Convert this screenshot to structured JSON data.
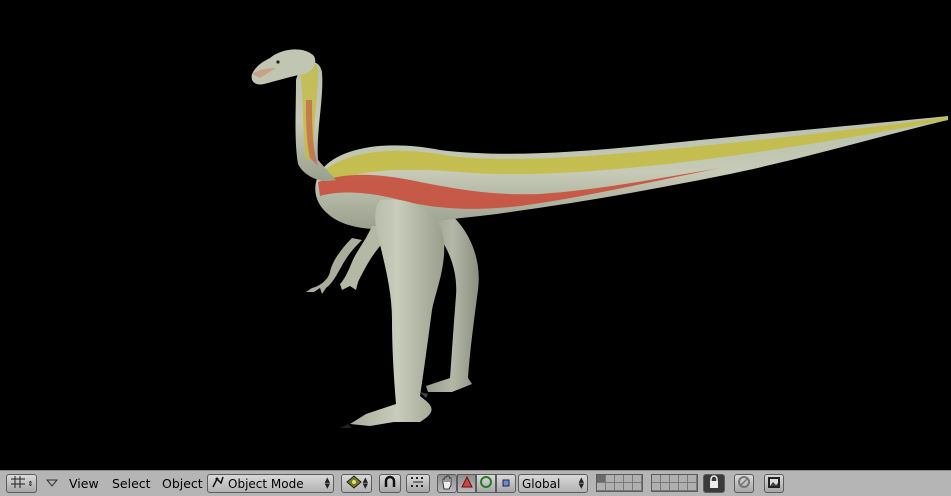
{
  "header": {
    "menus": {
      "view": "View",
      "select": "Select",
      "object": "Object"
    },
    "mode_select": {
      "value": "Object Mode"
    },
    "orientation_select": {
      "value": "Global"
    },
    "layers": {
      "group1_active_index": 0
    }
  },
  "icons": {
    "editor_type": "grid-icon",
    "menu_collapse": "triangle-down-icon",
    "mode": "object-mode-icon",
    "pivot": "pivot-cube-icon",
    "proportional": "magnet-icon",
    "snap": "snap-dots-icon",
    "manipulator": "hand-icon",
    "translate": "triangle-icon",
    "rotate": "circle-icon",
    "scale": "square-icon",
    "lock": "lock-icon",
    "restrict": "link-icon",
    "render": "image-icon"
  },
  "colors": {
    "viewport_bg": "#000000",
    "header_bg": "#b5b5b5",
    "skin": "#c3c8b4",
    "stripe_yellow": "#c8c040",
    "stripe_red": "#cc5544"
  }
}
